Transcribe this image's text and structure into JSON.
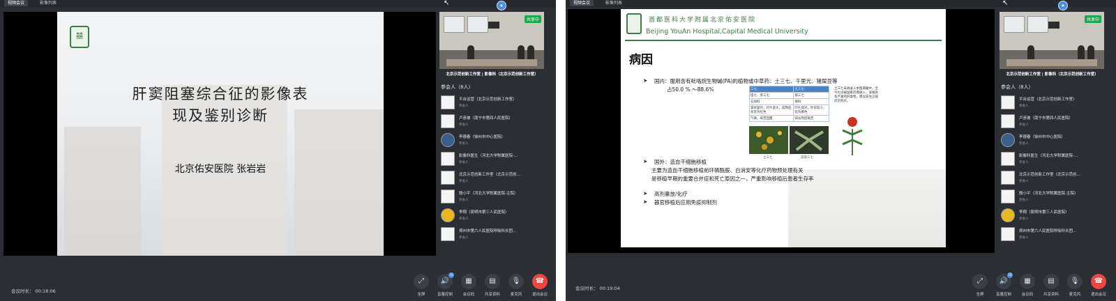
{
  "screens": [
    {
      "tabs": [
        "视频会议",
        "影像列表"
      ],
      "slide": {
        "title_line1": "肝窦阻塞综合征的影像表",
        "title_line2": "现及鉴别诊断",
        "presenter": "北京佑安医院  张岩岩"
      },
      "camera": {
        "sharing_badge": "共享中",
        "caption": "北京示范创新工作室 | 影像科（北京示范创新工作室）"
      },
      "participants_title": "参会人（8人）",
      "participants": [
        {
          "name": "平台运营（北京示范创新工作室）",
          "role": "参会人"
        },
        {
          "name": "卢彦玻（南宁市第四人民医院）",
          "role": "参会人"
        },
        {
          "name": "李德春（徐州市中心医院）",
          "role": "参会人"
        },
        {
          "name": "影像科医生（河北大学附属医院-...",
          "role": "参会人"
        },
        {
          "name": "北京示范创新工作室（北京示范创...",
          "role": "参会人"
        },
        {
          "name": "殷小平（河北大学附属医院-主院）",
          "role": "参会人"
        },
        {
          "name": "李翔（昆明市第三人民医院）",
          "role": "参会人"
        },
        {
          "name": "郑州市第六人民医院呼吸科长团...",
          "role": "参会人"
        }
      ],
      "duration": "会议时长： 00:18:06",
      "volume_badge": "10",
      "controls": [
        "全屏",
        "音量控制",
        "会议码",
        "共享资料",
        "麦克风",
        "退出会议"
      ]
    },
    {
      "tabs": [
        "视频会议",
        "影像列表"
      ],
      "slide": {
        "hospital_cn": "首都医科大学附属北京佑安医院",
        "hospital_en": "Beijing YouAn Hospital,Capital Medical University",
        "heading": "病因",
        "bullet1_line1": "国内：服用含有吡咯烷生物碱(PA)的植物或中草药：土三七、千里光、猪屎豆等",
        "bullet1_line2": "占50.0 % ～88.6%",
        "table_header": [
          "三七",
          "土三七"
        ],
        "table_rows": [
          [
            "田七、参三七",
            "菊三七"
          ],
          [
            "五加科",
            "菊科"
          ],
          [
            "掌状复叶，叶片宽大，成熟后有花为红色",
            "叶片成对，叶形较小，花为黄色"
          ],
          [
            "气微，味苦回甜",
            "味淡而后微苦"
          ]
        ],
        "note": "土三七未收录入中医典籍中，至今也没被国家药典收入，该植具有严重的肝毒性，建议前往正规药店购买。",
        "caption_left": "土三七",
        "caption_right": "菜第三七",
        "bullet2_title": "国外：造血干细胞移植",
        "bullet2_line1": "主要为造血干细胞移植前环磷酰胺、白消安等化疗药物预处理有关",
        "bullet2_line2": "是移植早期的重要合并症和死亡原因之一，严重影响移植后患者生存率",
        "bullet3": "高剂量放/化疗",
        "bullet4": "器官移植后应用免疫抑制剂"
      },
      "camera": {
        "sharing_badge": "共享中",
        "caption": "北京示范创新工作室 | 影像科（北京示范创新工作室）"
      },
      "participants_title": "参会人（8人）",
      "participants": [
        {
          "name": "平台运营（北京示范创新工作室）",
          "role": "参会人"
        },
        {
          "name": "卢彦玻（南宁市第四人民医院）",
          "role": "参会人"
        },
        {
          "name": "李德春（徐州市中心医院）",
          "role": "参会人"
        },
        {
          "name": "影像科医生（河北大学附属医院-...",
          "role": "参会人"
        },
        {
          "name": "北京示范创新工作室（北京示范创...",
          "role": "参会人"
        },
        {
          "name": "殷小平（河北大学附属医院-主院）",
          "role": "参会人"
        },
        {
          "name": "李翔（昆明市第三人民医院）",
          "role": "参会人"
        },
        {
          "name": "郑州市第六人民医院呼吸科长团...",
          "role": "参会人"
        }
      ],
      "duration": "会议时长： 00:19:04",
      "volume_badge": "10",
      "controls": [
        "全屏",
        "音量控制",
        "会议码",
        "共享资料",
        "麦克风",
        "退出会议"
      ]
    }
  ]
}
